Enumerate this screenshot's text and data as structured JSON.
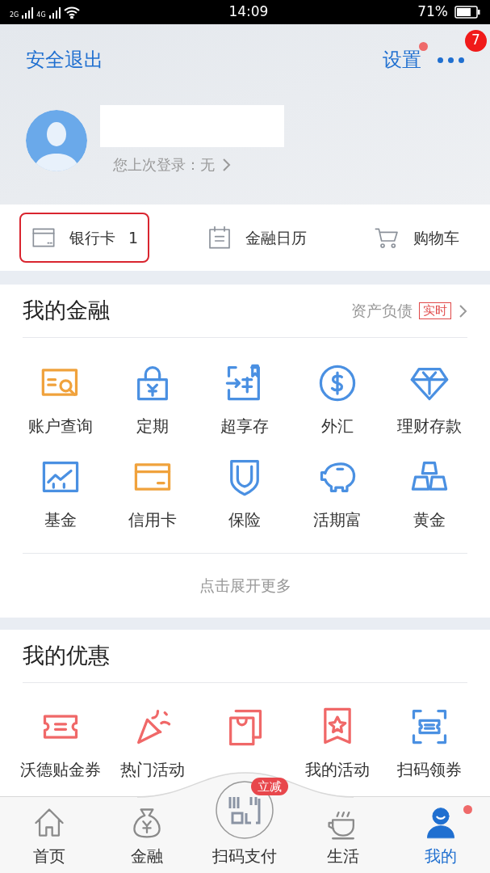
{
  "status_bar": {
    "network_1": "2G",
    "network_2": "4G",
    "time": "14:09",
    "battery": "71%"
  },
  "header": {
    "logout": "安全退出",
    "settings": "设置",
    "settings_dot": true,
    "more_badge": "7",
    "last_login": "您上次登录：无"
  },
  "shortcuts": [
    {
      "label": "银行卡",
      "count": "1",
      "highlighted": true
    },
    {
      "label": "金融日历",
      "highlighted": false
    },
    {
      "label": "购物车",
      "highlighted": false
    }
  ],
  "finance": {
    "title": "我的金融",
    "link": "资产负债",
    "tag": "实时",
    "more": "点击展开更多",
    "items": [
      {
        "label": "账户查询"
      },
      {
        "label": "定期"
      },
      {
        "label": "超享存"
      },
      {
        "label": "外汇"
      },
      {
        "label": "理财存款"
      },
      {
        "label": "基金"
      },
      {
        "label": "信用卡"
      },
      {
        "label": "保险"
      },
      {
        "label": "活期富"
      },
      {
        "label": "黄金"
      }
    ]
  },
  "offers": {
    "title": "我的优惠",
    "items": [
      {
        "kind": "labeled",
        "label": "沃德贴金券"
      },
      {
        "kind": "labeled",
        "label": "热门活动"
      },
      {
        "kind": "icon_only"
      },
      {
        "kind": "labeled",
        "label": "我的活动"
      },
      {
        "kind": "labeled",
        "label": "扫码领券"
      }
    ]
  },
  "tabs": [
    {
      "label": "首页",
      "selected": false
    },
    {
      "label": "金融",
      "selected": false
    },
    {
      "label": "扫码支付",
      "selected": false,
      "badge": "立减"
    },
    {
      "label": "生活",
      "selected": false
    },
    {
      "label": "我的",
      "selected": true,
      "dot": true
    }
  ]
}
